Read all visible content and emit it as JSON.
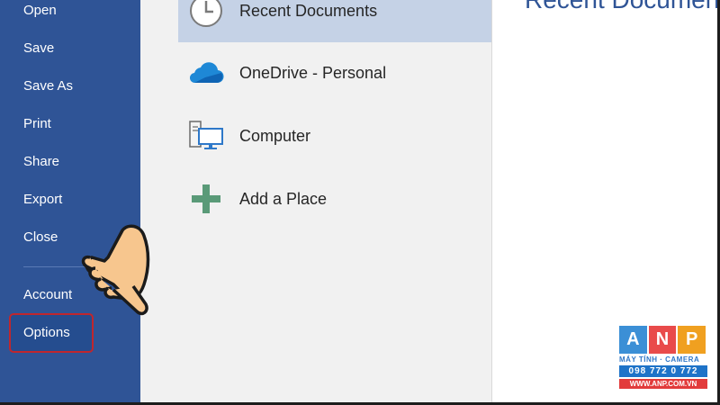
{
  "sidebar": {
    "items": [
      {
        "label": "Open"
      },
      {
        "label": "Save"
      },
      {
        "label": "Save As"
      },
      {
        "label": "Print"
      },
      {
        "label": "Share"
      },
      {
        "label": "Export"
      },
      {
        "label": "Close"
      },
      {
        "label": "Account"
      },
      {
        "label": "Options"
      }
    ],
    "selected": "Options"
  },
  "places": [
    {
      "label": "Recent Documents",
      "icon": "clock-icon",
      "active": true
    },
    {
      "label": "OneDrive - Personal",
      "icon": "cloud-icon"
    },
    {
      "label": "Computer",
      "icon": "computer-icon"
    },
    {
      "label": "Add a Place",
      "icon": "plus-icon"
    }
  ],
  "right_panel": {
    "title": "Recent Documents"
  },
  "overlay": {
    "hand_pointer": "pointing-hand-icon"
  },
  "watermark": {
    "letters": [
      "A",
      "N",
      "P"
    ],
    "tagline": "MÁY TÍNH · CAMERA",
    "phone": "098 772 0 772",
    "website": "WWW.ANP.COM.VN"
  },
  "colors": {
    "sidebar": "#2f5496",
    "highlight": "#c0262d",
    "active_place": "#c5d2e6",
    "add_icon": "#5a9a78",
    "cloud_icon": "#1e88d6"
  }
}
